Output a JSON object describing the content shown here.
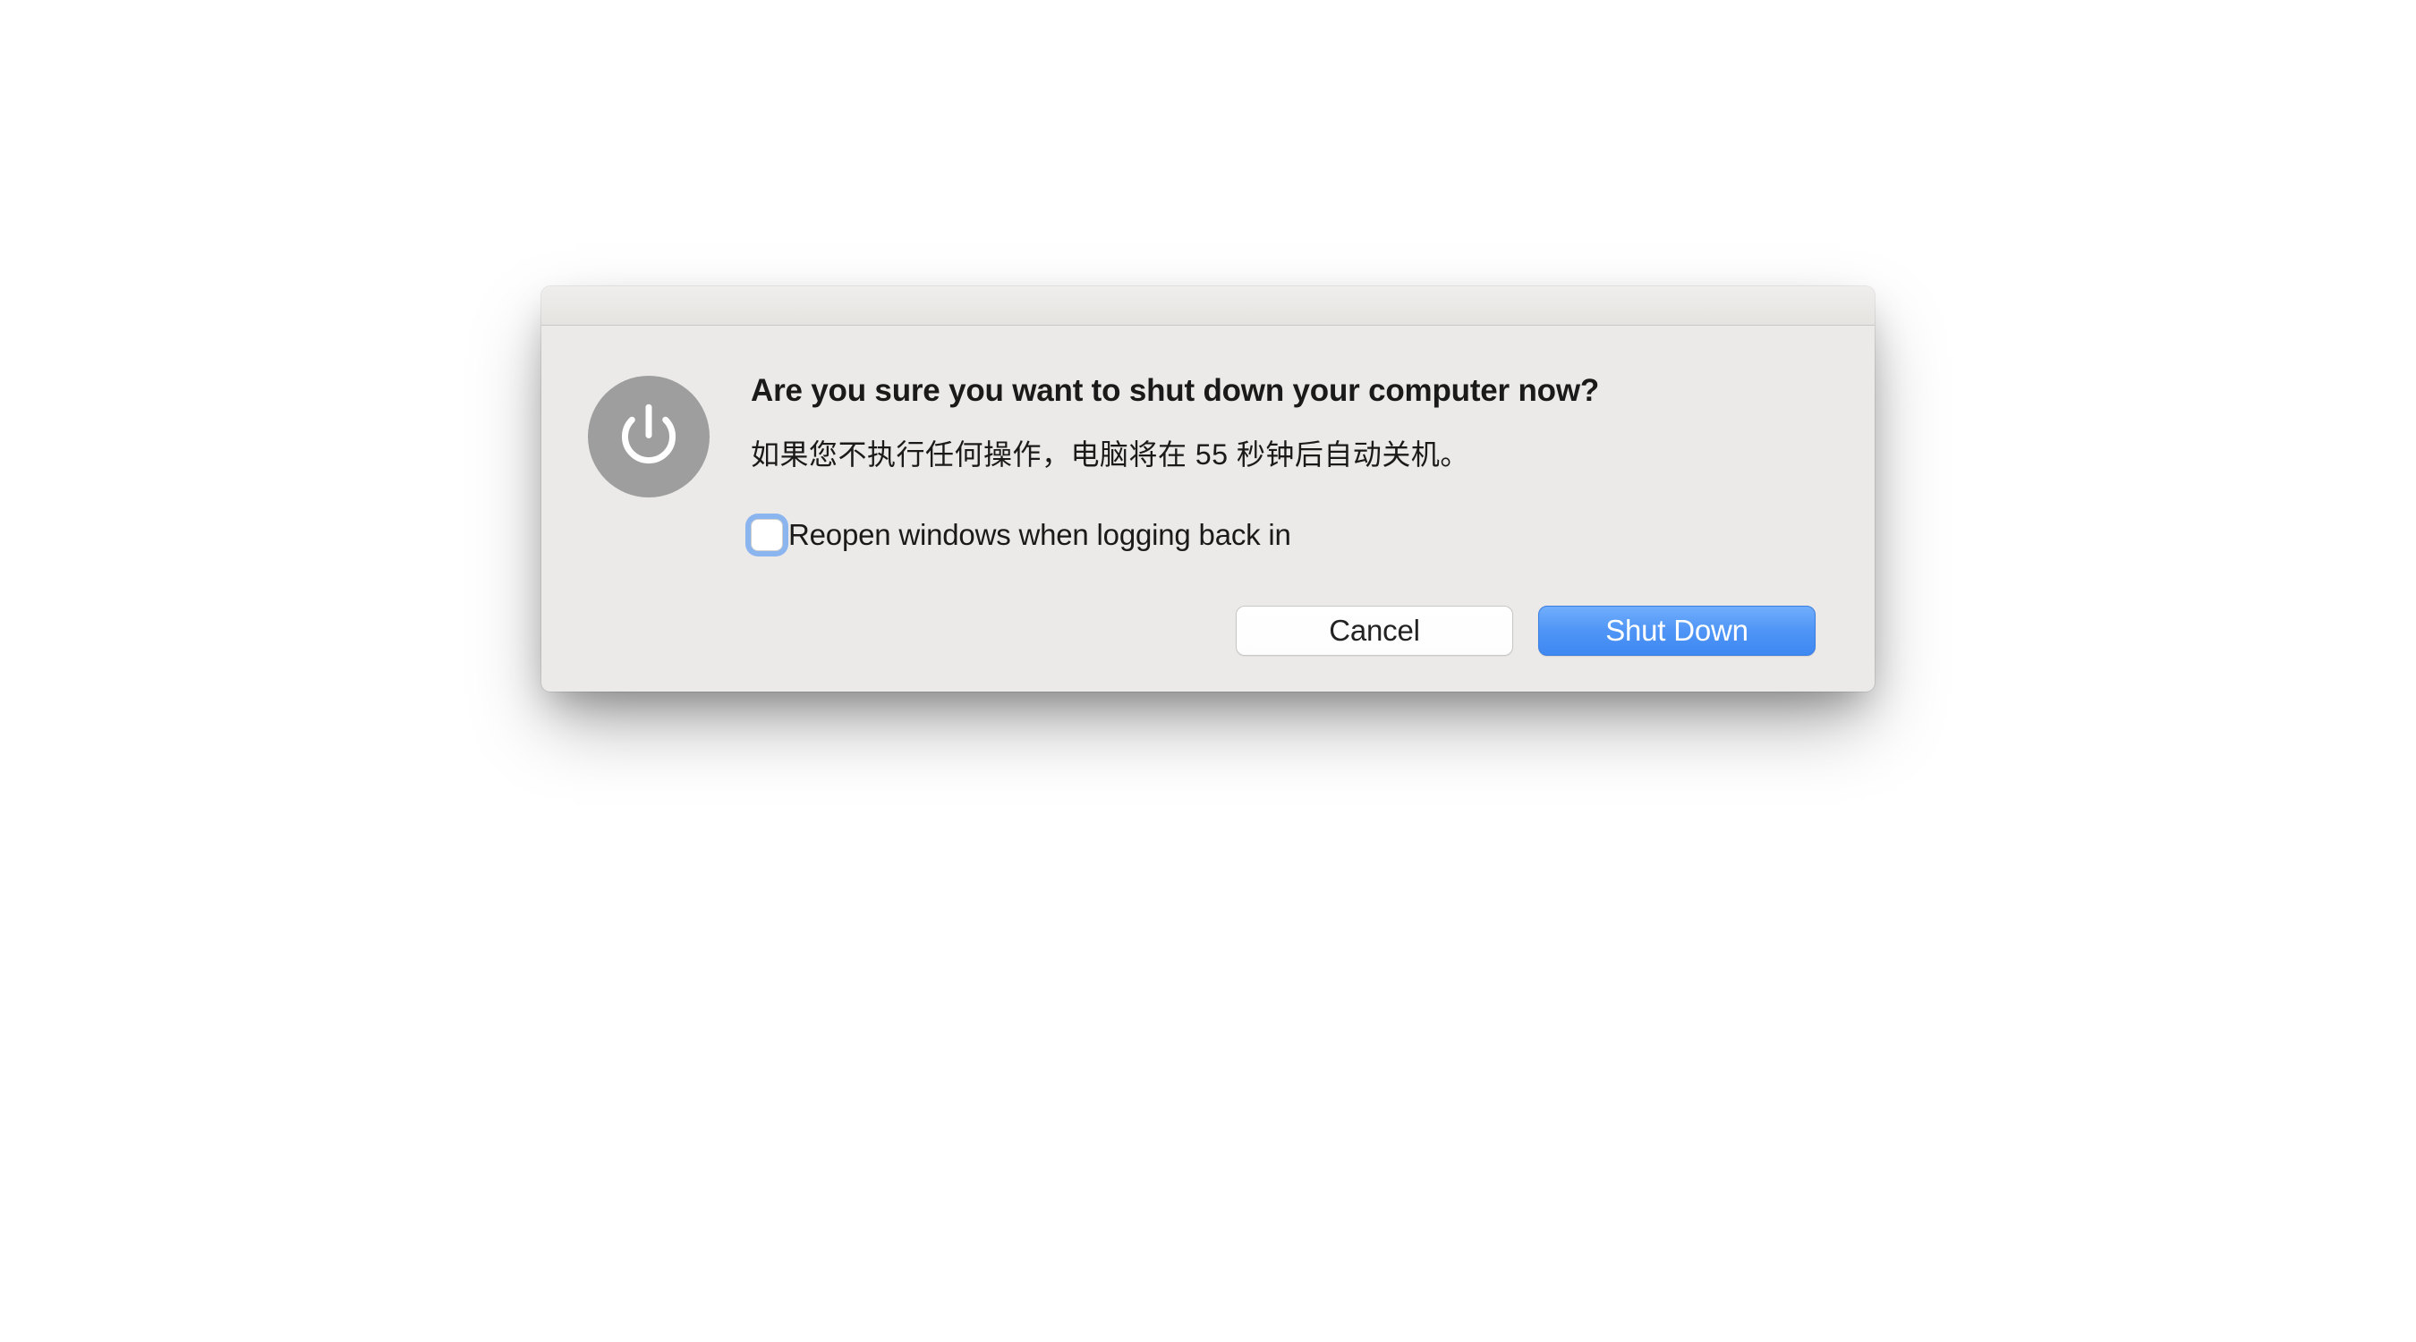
{
  "dialog": {
    "heading": "Are you sure you want to shut down your computer now?",
    "subtext": "如果您不执行任何操作，电脑将在 55 秒钟后自动关机。",
    "checkbox_label": "Reopen windows when logging back in",
    "checkbox_checked": false,
    "buttons": {
      "cancel": "Cancel",
      "confirm": "Shut Down"
    },
    "icon": "power-icon",
    "colors": {
      "dialog_bg": "#eceae8",
      "primary_button": "#4f95f6",
      "icon_bg": "#9e9e9e"
    }
  }
}
